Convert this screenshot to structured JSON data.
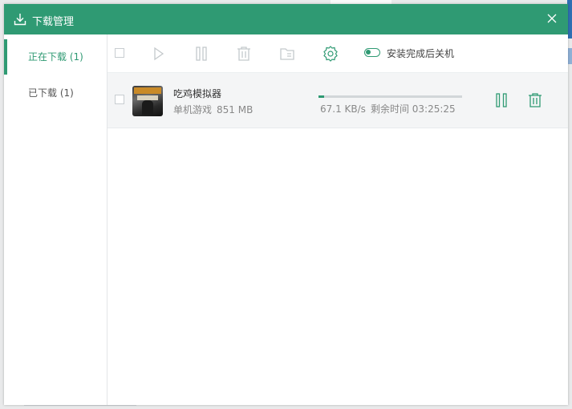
{
  "window": {
    "title": "下载管理"
  },
  "sidebar": {
    "items": [
      {
        "label": "正在下载 (1)",
        "active": true
      },
      {
        "label": "已下载 (1)",
        "active": false
      }
    ]
  },
  "toolbar": {
    "auto_shutdown_label": "安装完成后关机",
    "auto_shutdown_enabled": false
  },
  "downloads": [
    {
      "name": "吃鸡模拟器",
      "category": "单机游戏",
      "size": "851 MB",
      "speed": "67.1 KB/s",
      "remaining": "剩余时间 03:25:25",
      "progress": 0.04
    }
  ],
  "colors": {
    "accent": "#2f9a73",
    "icon_gray": "#c4c9cc"
  }
}
